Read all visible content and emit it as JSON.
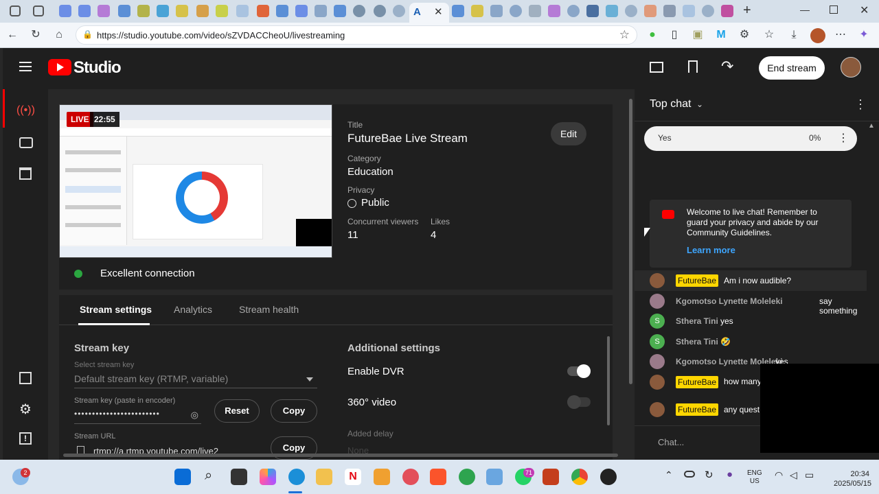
{
  "browser": {
    "url": "https://studio.youtube.com/video/sZVDACCheoU/livestreaming"
  },
  "studio": {
    "logo_text": "Studio",
    "end_stream_label": "End stream"
  },
  "preview": {
    "live_badge": "LIVE",
    "timer": "22:55",
    "connection_status": "Excellent connection"
  },
  "details": {
    "title_label": "Title",
    "title_value": "FutureBae Live Stream",
    "edit_label": "Edit",
    "category_label": "Category",
    "category_value": "Education",
    "privacy_label": "Privacy",
    "privacy_value": "Public",
    "viewers_label": "Concurrent viewers",
    "viewers_value": "11",
    "likes_label": "Likes",
    "likes_value": "4"
  },
  "tabs": [
    {
      "label": "Stream settings"
    },
    {
      "label": "Analytics"
    },
    {
      "label": "Stream health"
    }
  ],
  "stream_key": {
    "section_title": "Stream key",
    "select_label": "Select stream key",
    "select_value": "Default stream key (RTMP, variable)",
    "key_label": "Stream key (paste in encoder)",
    "key_value": "••••••••••••••••••••••••",
    "reset_label": "Reset",
    "copy_label": "Copy",
    "url_label": "Stream URL",
    "url_value": "rtmp://a.rtmp.youtube.com/live2",
    "url_copy_label": "Copy"
  },
  "additional": {
    "section_title": "Additional settings",
    "dvr_label": "Enable DVR",
    "dvr_enabled": true,
    "video360_label": "360° video",
    "video360_enabled": false,
    "delay_label": "Added delay",
    "delay_value": "None"
  },
  "chat": {
    "mode_label": "Top chat",
    "poll_option": "Yes",
    "poll_percent": "0%",
    "welcome_text": "Welcome to live chat! Remember to guard your privacy and abide by our Community Guidelines.",
    "learn_more": "Learn more",
    "input_placeholder": "Chat...",
    "messages": [
      {
        "author": "FutureBae",
        "owner": true,
        "text": "Am i now audible?",
        "avatar_color": "#8a5a3c"
      },
      {
        "author": "Kgomotso Lynette Moleleki",
        "owner": false,
        "text": "say something",
        "avatar_color": "#9a7a8a"
      },
      {
        "author": "Sthera Tini",
        "owner": false,
        "text": "yes",
        "avatar_color": "#4caf50",
        "initial": "S"
      },
      {
        "author": "Sthera Tini",
        "owner": false,
        "text": "🤣",
        "avatar_color": "#4caf50",
        "initial": "S"
      },
      {
        "author": "Kgomotso Lynette Moleleki",
        "owner": false,
        "text": "yes",
        "avatar_color": "#9a7a8a"
      },
      {
        "author": "FutureBae",
        "owner": true,
        "text": "how many already?",
        "avatar_color": "#8a5a3c"
      },
      {
        "author": "FutureBae",
        "owner": true,
        "text": "any quest",
        "avatar_color": "#8a5a3c"
      }
    ]
  },
  "taskbar": {
    "weather_badge": "2",
    "whatsapp_badge": "71",
    "lang_top": "ENG",
    "lang_bottom": "US",
    "time": "20:34",
    "date": "2025/05/15"
  }
}
